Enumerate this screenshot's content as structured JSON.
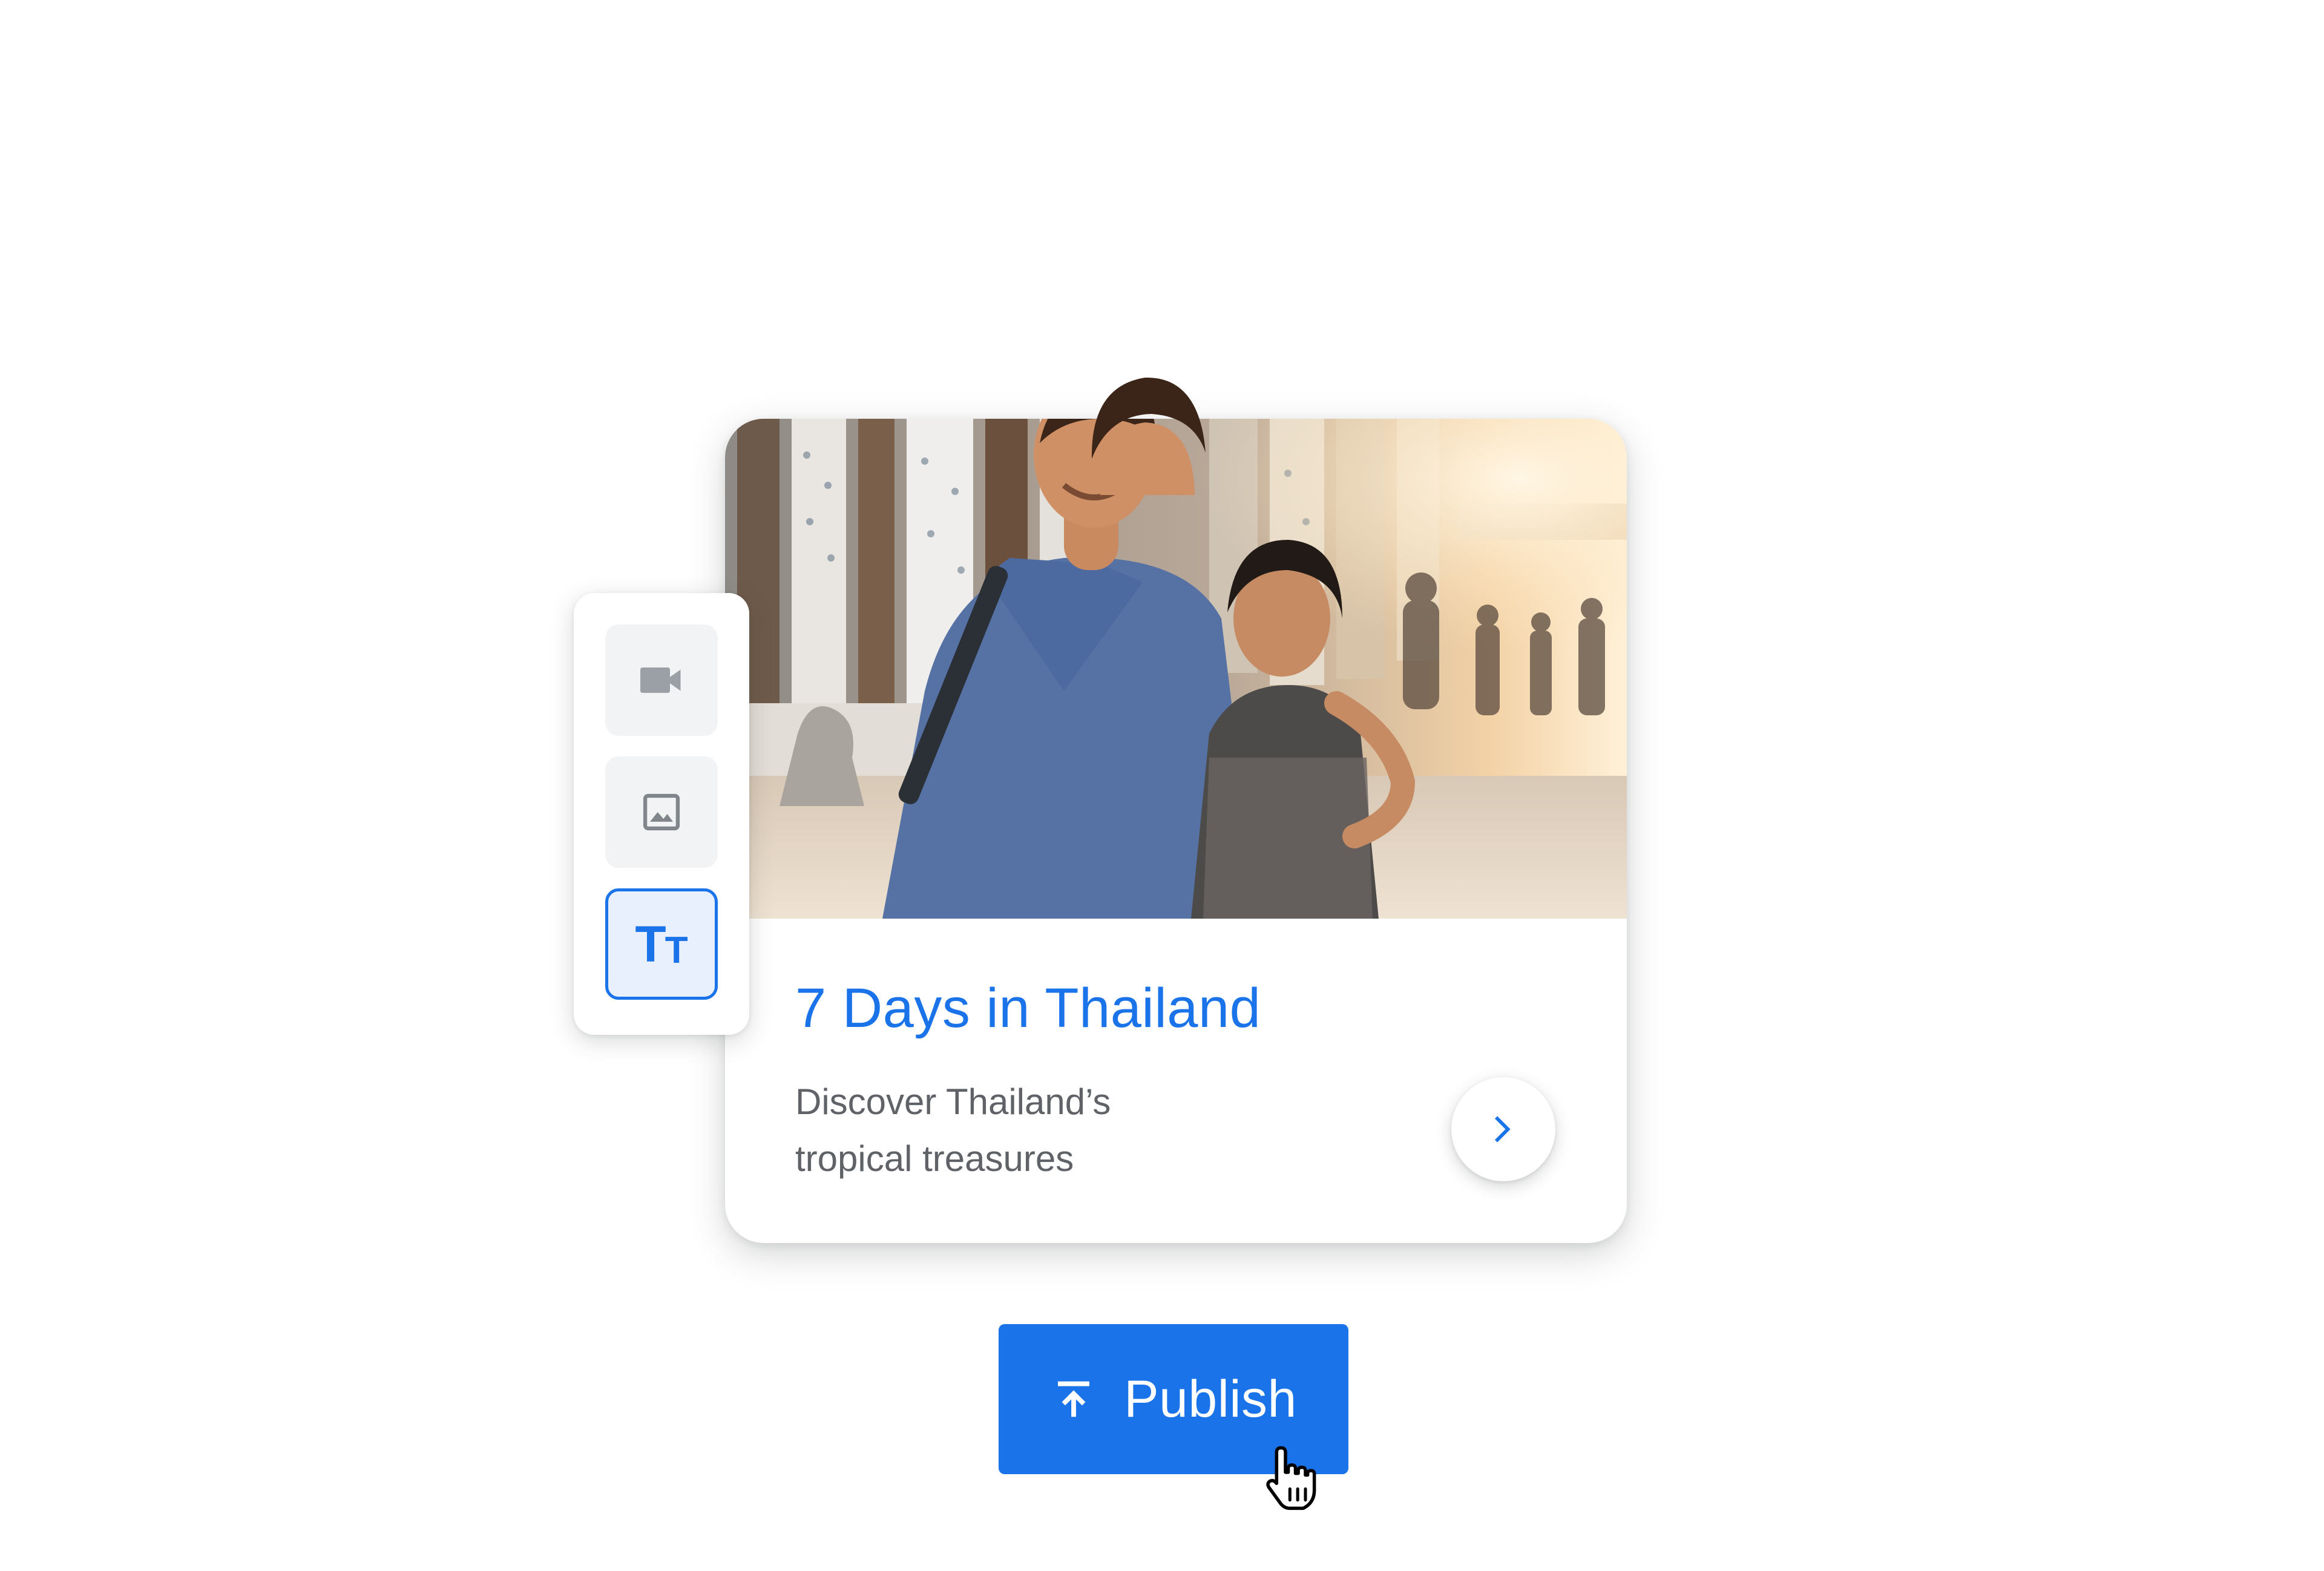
{
  "card": {
    "image_alt": "Couple smiling in front of a temple",
    "title": "7 Days in Thailand",
    "description_line1": "Discover Thailand’s",
    "description_line2": "tropical treasures",
    "next_icon": "chevron-right-icon"
  },
  "toolbar": {
    "tools": [
      {
        "name": "video",
        "icon": "video-camera-icon",
        "selected": false
      },
      {
        "name": "image",
        "icon": "image-icon",
        "selected": false
      },
      {
        "name": "text",
        "icon": "text-size-icon",
        "label_big": "T",
        "label_small": "T",
        "selected": true
      }
    ]
  },
  "publish_button": {
    "label": "Publish",
    "icon": "upload-icon"
  },
  "colors": {
    "accent": "#1a73e8",
    "text_secondary": "#5f6368",
    "tool_bg": "#f1f3f4",
    "tool_selected_bg": "#e8f0fe"
  }
}
